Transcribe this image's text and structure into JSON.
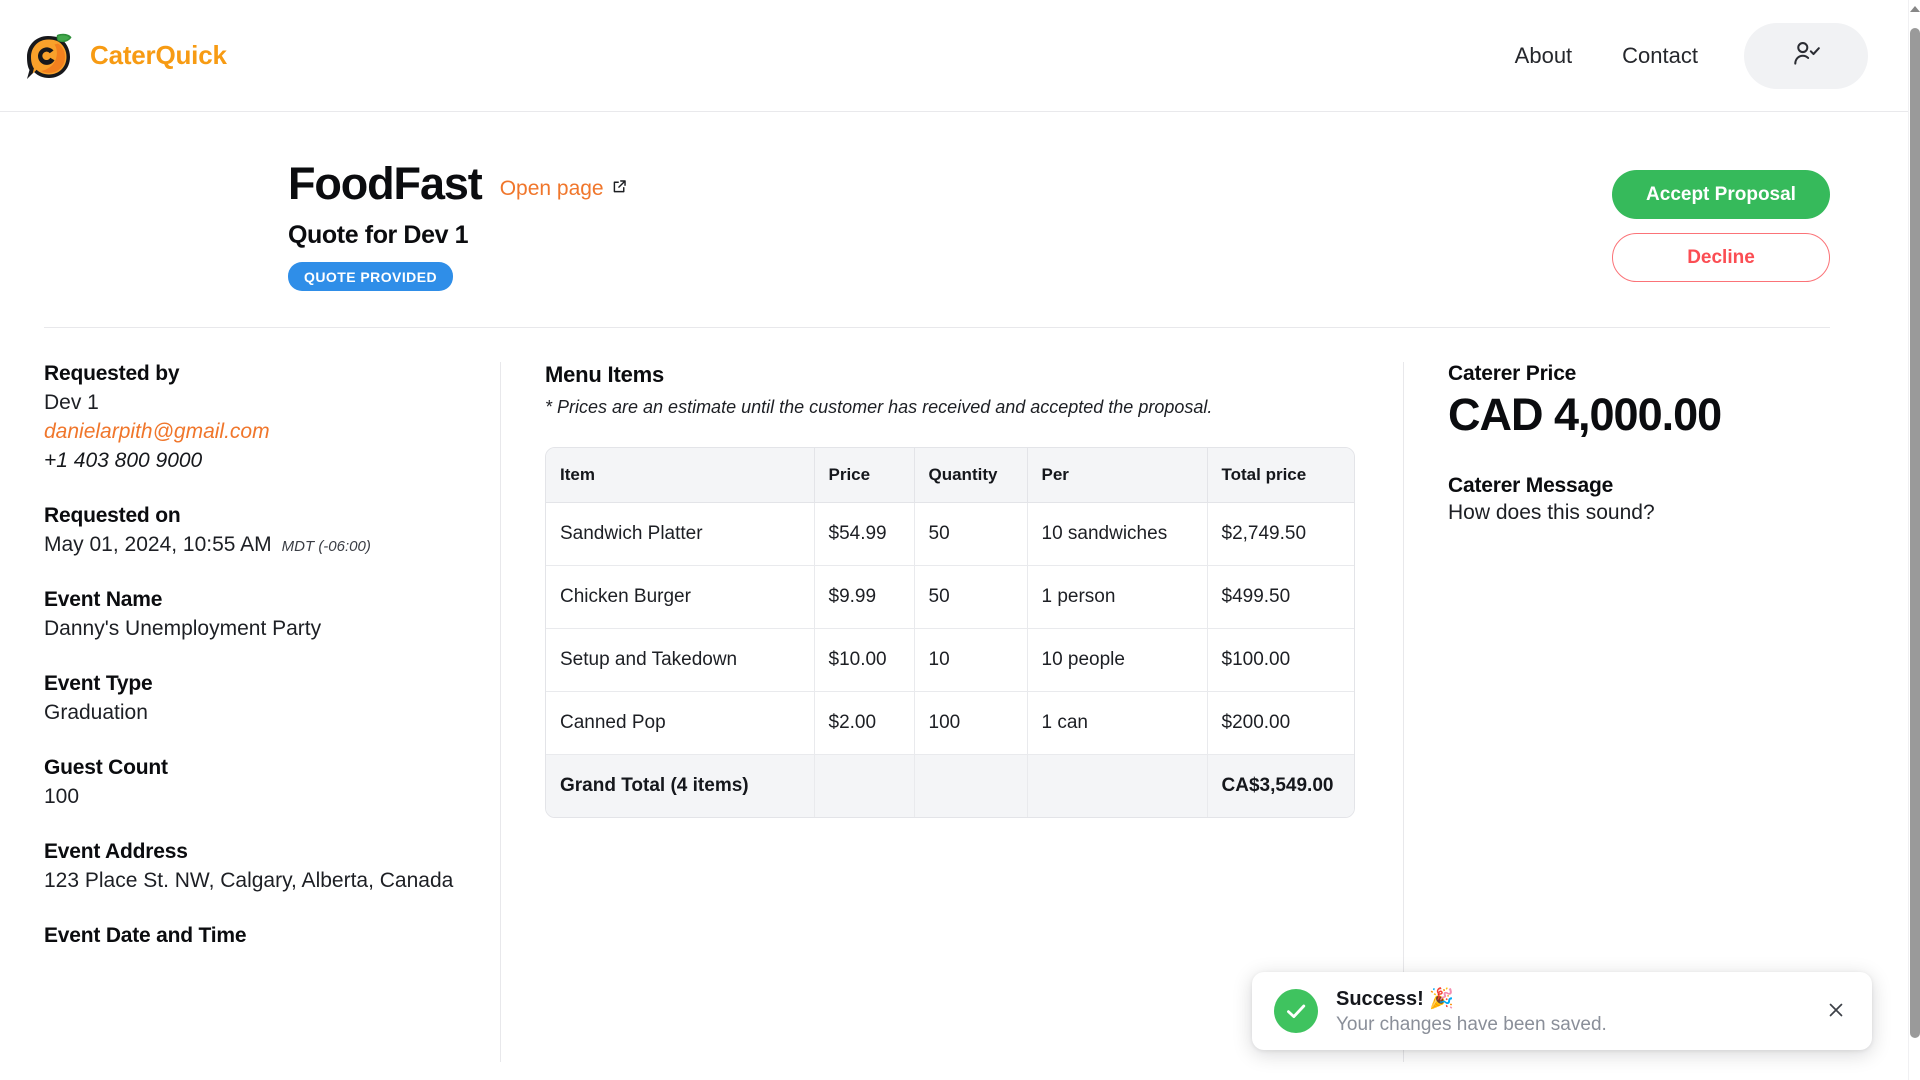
{
  "header": {
    "brand_name": "CaterQuick",
    "logo_icon": "caterquick-lemon-logo",
    "nav": [
      {
        "label": "About",
        "name": "about"
      },
      {
        "label": "Contact",
        "name": "contact"
      }
    ],
    "account_icon": "user-check-icon"
  },
  "quote": {
    "org_title": "FoodFast",
    "open_page_label": "Open page",
    "open_page_icon": "external-link-icon",
    "subtitle": "Quote for Dev 1",
    "status_badge": "QUOTE PROVIDED",
    "status_badge_color": "#2f8ee8",
    "accept_label": "Accept Proposal",
    "accept_color": "#36ba5b",
    "decline_label": "Decline",
    "decline_color": "#fb4d53"
  },
  "details": {
    "requested_by_label": "Requested by",
    "requested_by_name": "Dev 1",
    "requested_by_email": "danielarpith@gmail.com",
    "requested_by_phone": "+1 403 800 9000",
    "requested_on_label": "Requested on",
    "requested_on_value": "May 01, 2024, 10:55 AM",
    "requested_on_tz": "MDT (-06:00)",
    "event_name_label": "Event Name",
    "event_name_value": "Danny's Unemployment Party",
    "event_type_label": "Event Type",
    "event_type_value": "Graduation",
    "guest_count_label": "Guest Count",
    "guest_count_value": "100",
    "event_address_label": "Event Address",
    "event_address_value": "123 Place St. NW, Calgary, Alberta, Canada",
    "event_datetime_label": "Event Date and Time"
  },
  "menu": {
    "section_title": "Menu Items",
    "disclaimer": "* Prices are an estimate until the customer has received and accepted the proposal.",
    "columns": [
      "Item",
      "Price",
      "Quantity",
      "Per",
      "Total price"
    ],
    "rows": [
      {
        "item": "Sandwich Platter",
        "price": "$54.99",
        "quantity": "50",
        "per": "10 sandwiches",
        "total": "$2,749.50"
      },
      {
        "item": "Chicken Burger",
        "price": "$9.99",
        "quantity": "50",
        "per": "1 person",
        "total": "$499.50"
      },
      {
        "item": "Setup and Takedown",
        "price": "$10.00",
        "quantity": "10",
        "per": "10 people",
        "total": "$100.00"
      },
      {
        "item": "Canned Pop",
        "price": "$2.00",
        "quantity": "100",
        "per": "1 can",
        "total": "$200.00"
      }
    ],
    "grand_total_label": "Grand Total (4 items)",
    "grand_total_value": "CA$3,549.00"
  },
  "caterer": {
    "price_label": "Caterer Price",
    "price_amount": "CAD 4,000.00",
    "message_label": "Caterer Message",
    "message_text": "How does this sound?"
  },
  "toast": {
    "title": "Success! 🎉",
    "message": "Your changes have been saved.",
    "icon": "check-circle-icon",
    "close_icon": "close-icon",
    "accent_color": "#3fc35f"
  }
}
